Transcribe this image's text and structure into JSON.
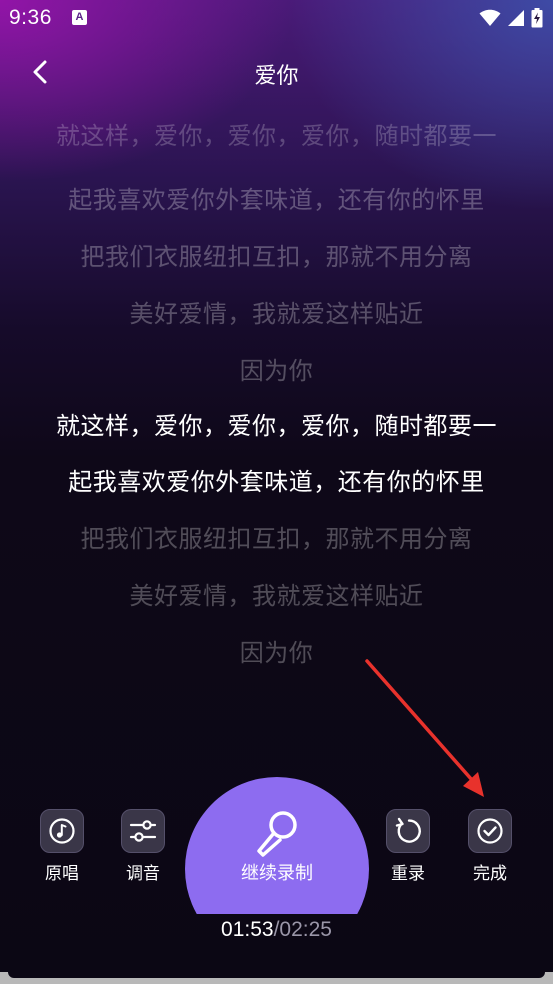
{
  "status_bar": {
    "time": "9:36",
    "app_icon_letter": "A",
    "icons": [
      "wifi-icon",
      "signal-icon",
      "battery-icon"
    ]
  },
  "header": {
    "title": "爱你",
    "back_icon": "chevron-left-icon"
  },
  "lyrics": {
    "lines": [
      {
        "text": "就这样，爱你，爱你，爱你，随时都要一",
        "state": "cut"
      },
      {
        "text": "起我喜欢爱你外套味道，还有你的怀里",
        "state": "dim"
      },
      {
        "text": "把我们衣服纽扣互扣，那就不用分离",
        "state": "dim"
      },
      {
        "text": "美好爱情，我就爱这样贴近",
        "state": "dim"
      },
      {
        "text": "因为你",
        "state": "dim"
      },
      {
        "text": "就这样，爱你，爱你，爱你，随时都要一",
        "state": "active"
      },
      {
        "text": "起我喜欢爱你外套味道，还有你的怀里",
        "state": "active"
      },
      {
        "text": "把我们衣服纽扣互扣，那就不用分离",
        "state": "dim"
      },
      {
        "text": "美好爱情，我就爱这样贴近",
        "state": "dim"
      },
      {
        "text": "因为你",
        "state": "dim"
      }
    ]
  },
  "controls": {
    "original_vocal": {
      "label": "原唱",
      "icon": "music-note-icon"
    },
    "tuning": {
      "label": "调音",
      "icon": "sliders-icon"
    },
    "record": {
      "label": "继续录制",
      "icon": "microphone-icon"
    },
    "rerecord": {
      "label": "重录",
      "icon": "redo-icon"
    },
    "finish": {
      "label": "完成",
      "icon": "check-circle-icon"
    }
  },
  "timer": {
    "current": "01:53",
    "separator": "/",
    "total": "02:25"
  },
  "colors": {
    "accent": "#8d6cf0",
    "annotation_arrow": "#e8322c",
    "control_bg": "#3a3648"
  }
}
